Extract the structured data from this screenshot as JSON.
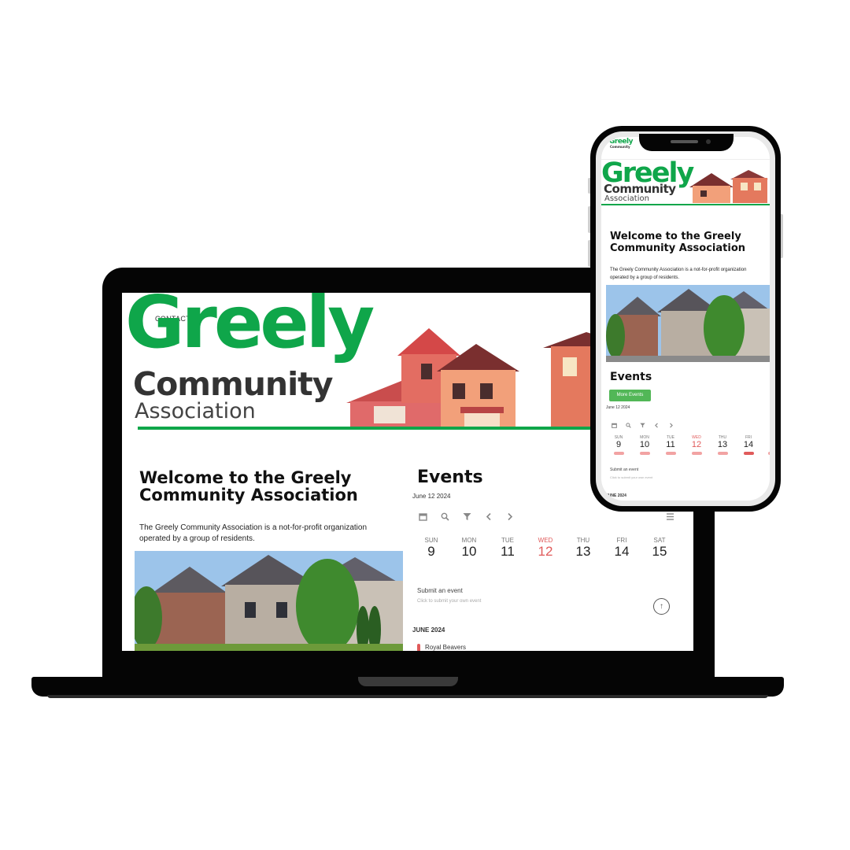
{
  "site": {
    "contact_label": "CONTACT US",
    "logo_line1": "Greely",
    "logo_line2": "Community",
    "logo_line3": "Association",
    "welcome_title_line1": "Welcome to the Greely",
    "welcome_title_line2": "Community Association",
    "welcome_text_line1": "The Greely Community Association is a not-for-profit organization",
    "welcome_text_line2": "operated by a group of residents."
  },
  "events": {
    "title": "Events",
    "more_button": "More Events",
    "current_date": "June 12 2024",
    "days": [
      {
        "name": "SUN",
        "num": "9"
      },
      {
        "name": "MON",
        "num": "10"
      },
      {
        "name": "TUE",
        "num": "11"
      },
      {
        "name": "WED",
        "num": "12"
      },
      {
        "name": "THU",
        "num": "13"
      },
      {
        "name": "FRI",
        "num": "14"
      },
      {
        "name": "SAT",
        "num": "15"
      }
    ],
    "today_index": 3,
    "submit_title": "Submit an event",
    "submit_subtitle": "Click to submit your own event",
    "month_heading": "JUNE 2024",
    "first_event": "Royal Beavers"
  },
  "colors": {
    "brand_green": "#0fa64a",
    "today_red": "#e05b5b",
    "button_green": "#52b757"
  },
  "icons": [
    "calendar-icon",
    "search-icon",
    "filter-icon",
    "chevron-left-icon",
    "chevron-right-icon",
    "menu-icon",
    "arrow-up-icon"
  ]
}
